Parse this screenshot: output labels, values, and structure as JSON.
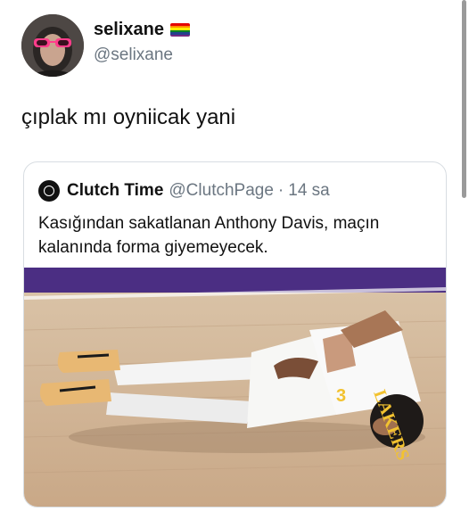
{
  "author": {
    "display_name": "selixane",
    "handle": "@selixane",
    "badge": "rainbow-flag-icon"
  },
  "tweet": {
    "text": "çıplak mı oyniicak yani"
  },
  "quoted": {
    "name": "Clutch Time",
    "handle": "@ClutchPage",
    "separator": "·",
    "time": "14 sa",
    "text": "Kasığından sakatlanan Anthony Davis, maçın kalanında forma giyemeyecek."
  },
  "colors": {
    "handle_gray": "#6b7681",
    "card_border": "#d8dde2",
    "court_purple": "#4b2e83",
    "jersey_gold": "#f2c230"
  }
}
